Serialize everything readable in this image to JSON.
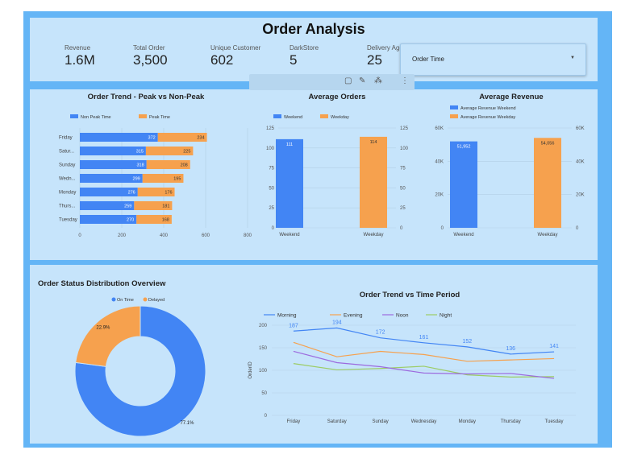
{
  "dashboard": {
    "title": "Order Analysis"
  },
  "kpis": [
    {
      "label": "Revenue",
      "value": "1.6M"
    },
    {
      "label": "Total Order",
      "value": "3,500"
    },
    {
      "label": "Unique Customer",
      "value": "602"
    },
    {
      "label": "DarkStore",
      "value": "5"
    },
    {
      "label": "Delivery Agent",
      "value": "25"
    }
  ],
  "filter": {
    "label": "Order Time",
    "caret": "▼"
  },
  "toolbar": {
    "icons": [
      "select-icon",
      "pencil-icon",
      "magic-icon",
      "more-icon"
    ],
    "glyphs": [
      "▢",
      "✎",
      "⁂",
      "⋮"
    ]
  },
  "chart_data": [
    {
      "type": "bar",
      "orientation": "horizontal",
      "stacked": true,
      "title": "Order Trend - Peak vs Non-Peak",
      "categories": [
        "Friday",
        "Satur...",
        "Sunday",
        "Wedn...",
        "Monday",
        "Thurs...",
        "Tuesday"
      ],
      "series": [
        {
          "name": "Non Peak Time",
          "values": [
            372,
            315,
            318,
            299,
            276,
            259,
            270
          ],
          "color": "#4285f4"
        },
        {
          "name": "Peak Time",
          "values": [
            234,
            225,
            208,
            195,
            176,
            181,
            168
          ],
          "color": "#f6a14e"
        }
      ],
      "xlim": [
        0,
        800
      ],
      "xticks": [
        "0",
        "200",
        "400",
        "600",
        "800"
      ],
      "legend": "top"
    },
    {
      "type": "bar",
      "title": "Average Orders",
      "categories": [
        "Weekend",
        "Weekday"
      ],
      "series": [
        {
          "name": "Weekend",
          "values": [
            111,
            null
          ],
          "color": "#4285f4"
        },
        {
          "name": "Weekday",
          "values": [
            null,
            114
          ],
          "color": "#f6a14e"
        }
      ],
      "labels": [
        "111",
        "114"
      ],
      "ylim": [
        0,
        125
      ],
      "yticks": [
        "0",
        "25",
        "50",
        "75",
        "100",
        "125"
      ],
      "legend": "top"
    },
    {
      "type": "bar",
      "title": "Average Revenue",
      "categories": [
        "Weekend",
        "Weekday"
      ],
      "series": [
        {
          "name": "Average Revenue Weekend",
          "values": [
            51952,
            null
          ],
          "color": "#4285f4"
        },
        {
          "name": "Average Revenue Weekday",
          "values": [
            null,
            54056
          ],
          "color": "#f6a14e"
        }
      ],
      "labels": [
        "51,952",
        "54,056"
      ],
      "ylim": [
        0,
        60000
      ],
      "yticks": [
        "0",
        "20K",
        "40K",
        "60K"
      ],
      "legend": "top"
    },
    {
      "type": "pie",
      "donut": true,
      "title": "Order Status Distribution Overview",
      "slices": [
        {
          "name": "On Time",
          "value": 77.1,
          "label": "77.1%",
          "color": "#4285f4"
        },
        {
          "name": "Delayed",
          "value": 22.9,
          "label": "22.9%",
          "color": "#f6a14e"
        }
      ],
      "legend": "top"
    },
    {
      "type": "line",
      "title": "Order Trend vs Time Period",
      "ylabel": "OrderID",
      "x": [
        "Friday",
        "Saturday",
        "Sunday",
        "Wednesday",
        "Monday",
        "Thursday",
        "Tuesday"
      ],
      "series": [
        {
          "name": "Morning",
          "values": [
            187,
            194,
            172,
            161,
            152,
            136,
            141
          ],
          "labels": [
            "187",
            "194",
            "172",
            "161",
            "152",
            "136",
            "141"
          ],
          "color": "#4285f4"
        },
        {
          "name": "Evening",
          "values": [
            162,
            130,
            142,
            135,
            120,
            123,
            126
          ],
          "color": "#f6a14e"
        },
        {
          "name": "Noon",
          "values": [
            142,
            117,
            108,
            94,
            92,
            93,
            82
          ],
          "color": "#9c6ade"
        },
        {
          "name": "Night",
          "values": [
            115,
            101,
            104,
            109,
            90,
            85,
            86
          ],
          "color": "#9ccc65"
        }
      ],
      "ylim": [
        0,
        200
      ],
      "yticks": [
        "0",
        "50",
        "100",
        "150",
        "200"
      ],
      "legend": "top"
    }
  ]
}
